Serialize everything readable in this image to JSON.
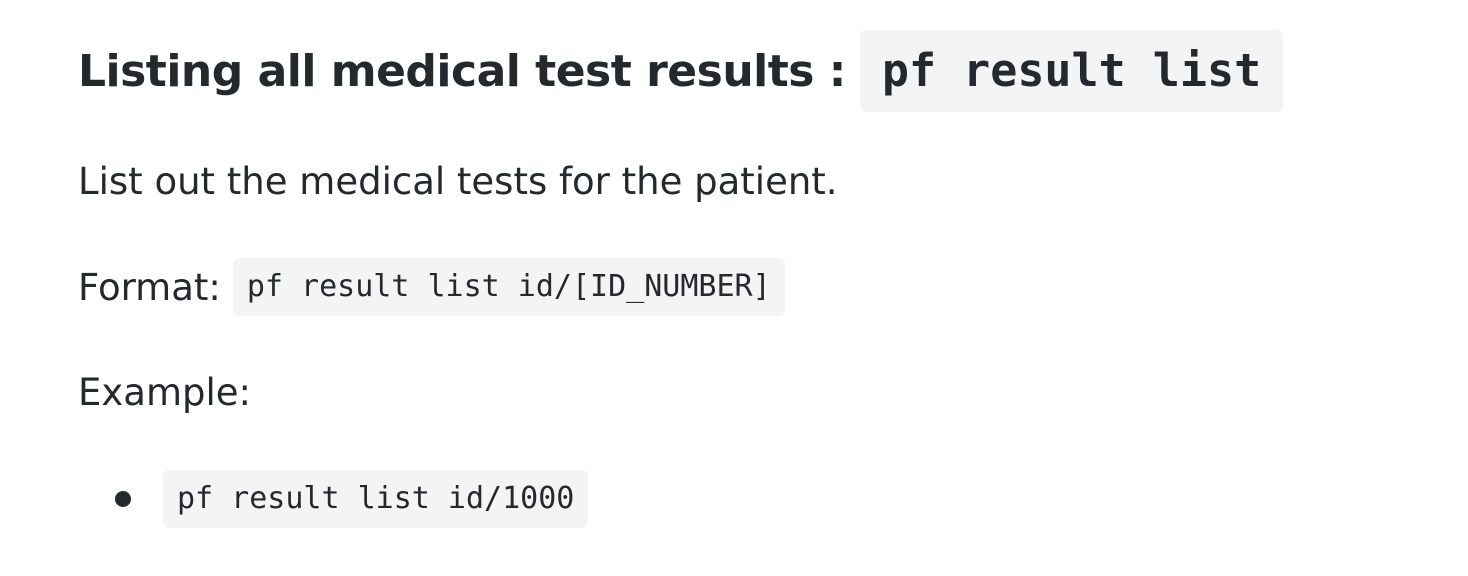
{
  "section": {
    "heading_text": "Listing all medical test results :",
    "heading_code": "pf result list",
    "description": "List out the medical tests for the patient.",
    "format_label": "Format:",
    "format_code": "pf result list id/[ID_NUMBER]",
    "example_label": "Example:",
    "examples": [
      "pf result list id/1000"
    ]
  }
}
